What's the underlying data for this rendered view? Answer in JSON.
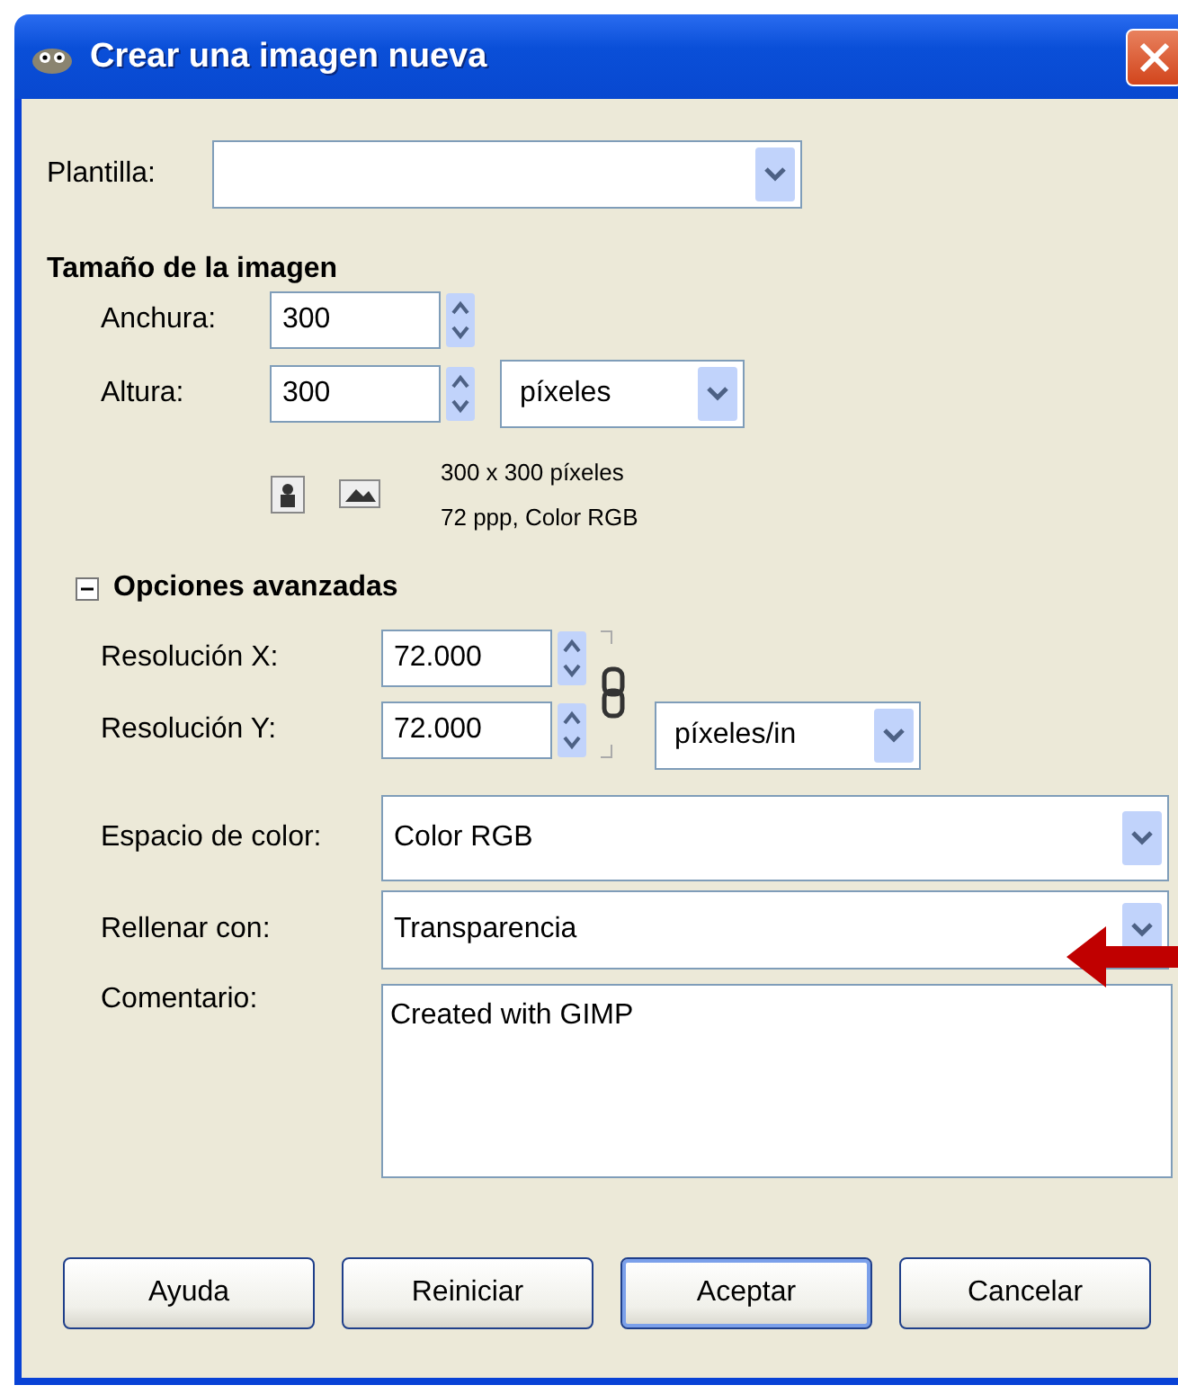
{
  "window": {
    "title": "Crear una imagen nueva"
  },
  "template": {
    "label": "Plantilla:"
  },
  "image_size": {
    "heading": "Tamaño de la imagen",
    "width": {
      "label": "Anchura:",
      "value": "300"
    },
    "height": {
      "label": "Altura:",
      "value": "300"
    },
    "unit": "píxeles",
    "info": [
      "300 x 300 píxeles",
      "72 ppp, Color RGB"
    ]
  },
  "advanced": {
    "heading": "Opciones avanzadas",
    "expanded": true,
    "resolution_x": {
      "label": "Resolución X:",
      "value": "72.000"
    },
    "resolution_y": {
      "label": "Resolución Y:",
      "value": "72.000"
    },
    "resolution_unit": "píxeles/in",
    "color_space": {
      "label": "Espacio de color:",
      "value": "Color RGB"
    },
    "fill": {
      "label": "Rellenar con:",
      "value": "Transparencia"
    },
    "comment": {
      "label": "Comentario:",
      "value": "Created with GIMP"
    }
  },
  "buttons": [
    {
      "label": "Ayuda",
      "default": false
    },
    {
      "label": "Reiniciar",
      "default": false
    },
    {
      "label": "Aceptar",
      "default": true
    },
    {
      "label": "Cancelar",
      "default": false
    }
  ]
}
